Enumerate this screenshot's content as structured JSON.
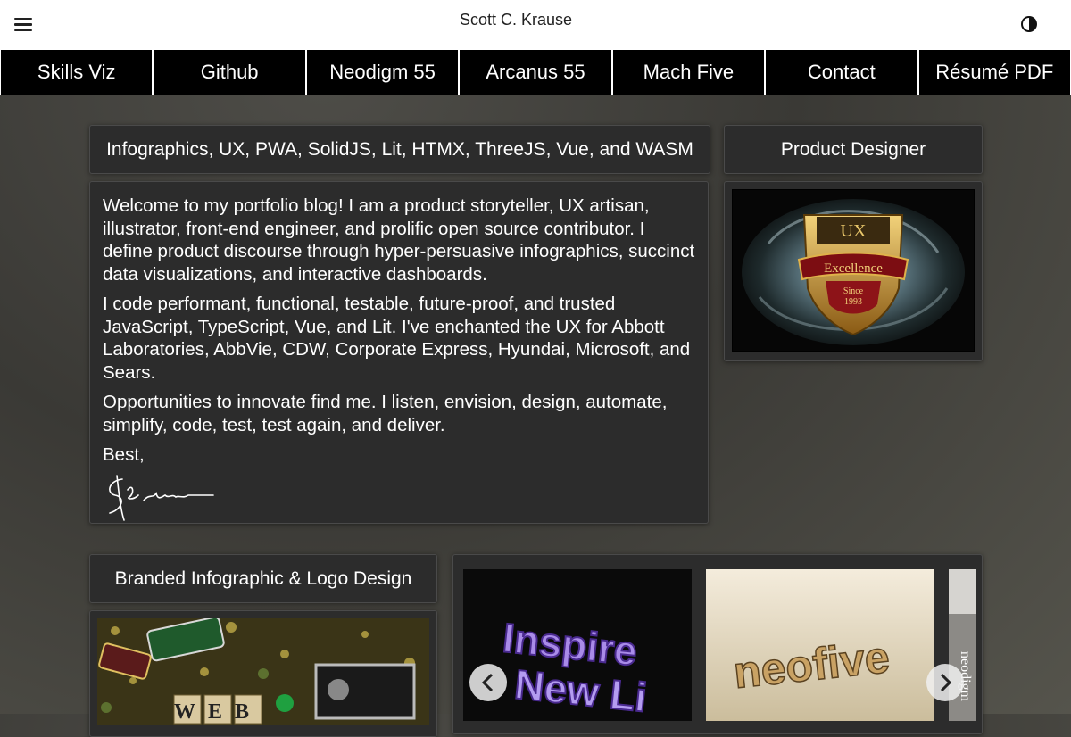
{
  "header": {
    "title": "Scott C. Krause",
    "menu_icon": "hamburger-icon",
    "theme_icon": "half-moon-icon"
  },
  "nav": [
    {
      "label": "Skills Viz"
    },
    {
      "label": "Github"
    },
    {
      "label": "Neodigm 55"
    },
    {
      "label": "Arcanus 55"
    },
    {
      "label": "Mach Five"
    },
    {
      "label": "Contact"
    },
    {
      "label": "Résumé PDF"
    }
  ],
  "intro": {
    "heading": "Infographics, UX, PWA, SolidJS, Lit, HTMX, ThreeJS, Vue, and WASM",
    "paragraphs": [
      "Welcome to my portfolio blog! I am a product storyteller, UX artisan, illustrator, front-end engineer, and prolific open source contributor. I define product discourse through hyper-persuasive infographics, succinct data visualizations, and interactive dashboards.",
      "I code performant, functional, testable, future-proof, and trusted JavaScript, TypeScript, Vue, and Lit. I've enchanted the UX for Abbott Laboratories, AbbVie, CDW, Corporate Express, Hyundai, Microsoft, and Sears.",
      "Opportunities to innovate find me. I listen, envision, design, automate, simplify, code, test, test again, and deliver."
    ],
    "closing": "Best,",
    "signature": "Scott Krause"
  },
  "product": {
    "heading": "Product Designer",
    "badge": {
      "top": "UX",
      "ribbon": "Excellence",
      "since": "Since",
      "year": "1993"
    }
  },
  "branded": {
    "heading": "Branded Infographic & Logo Design",
    "image_word": "WEB"
  },
  "carousel": {
    "slide1_text": "Inspire",
    "slide1_text2": "New Li",
    "slide2_text": "neofive",
    "slide3_text": "neodigm",
    "prev_icon": "chevron-left-icon",
    "next_icon": "chevron-right-icon"
  },
  "colors": {
    "nav_bg": "#000000",
    "card_bg": "#2c2c2c",
    "page_bg": "#3a3935"
  }
}
